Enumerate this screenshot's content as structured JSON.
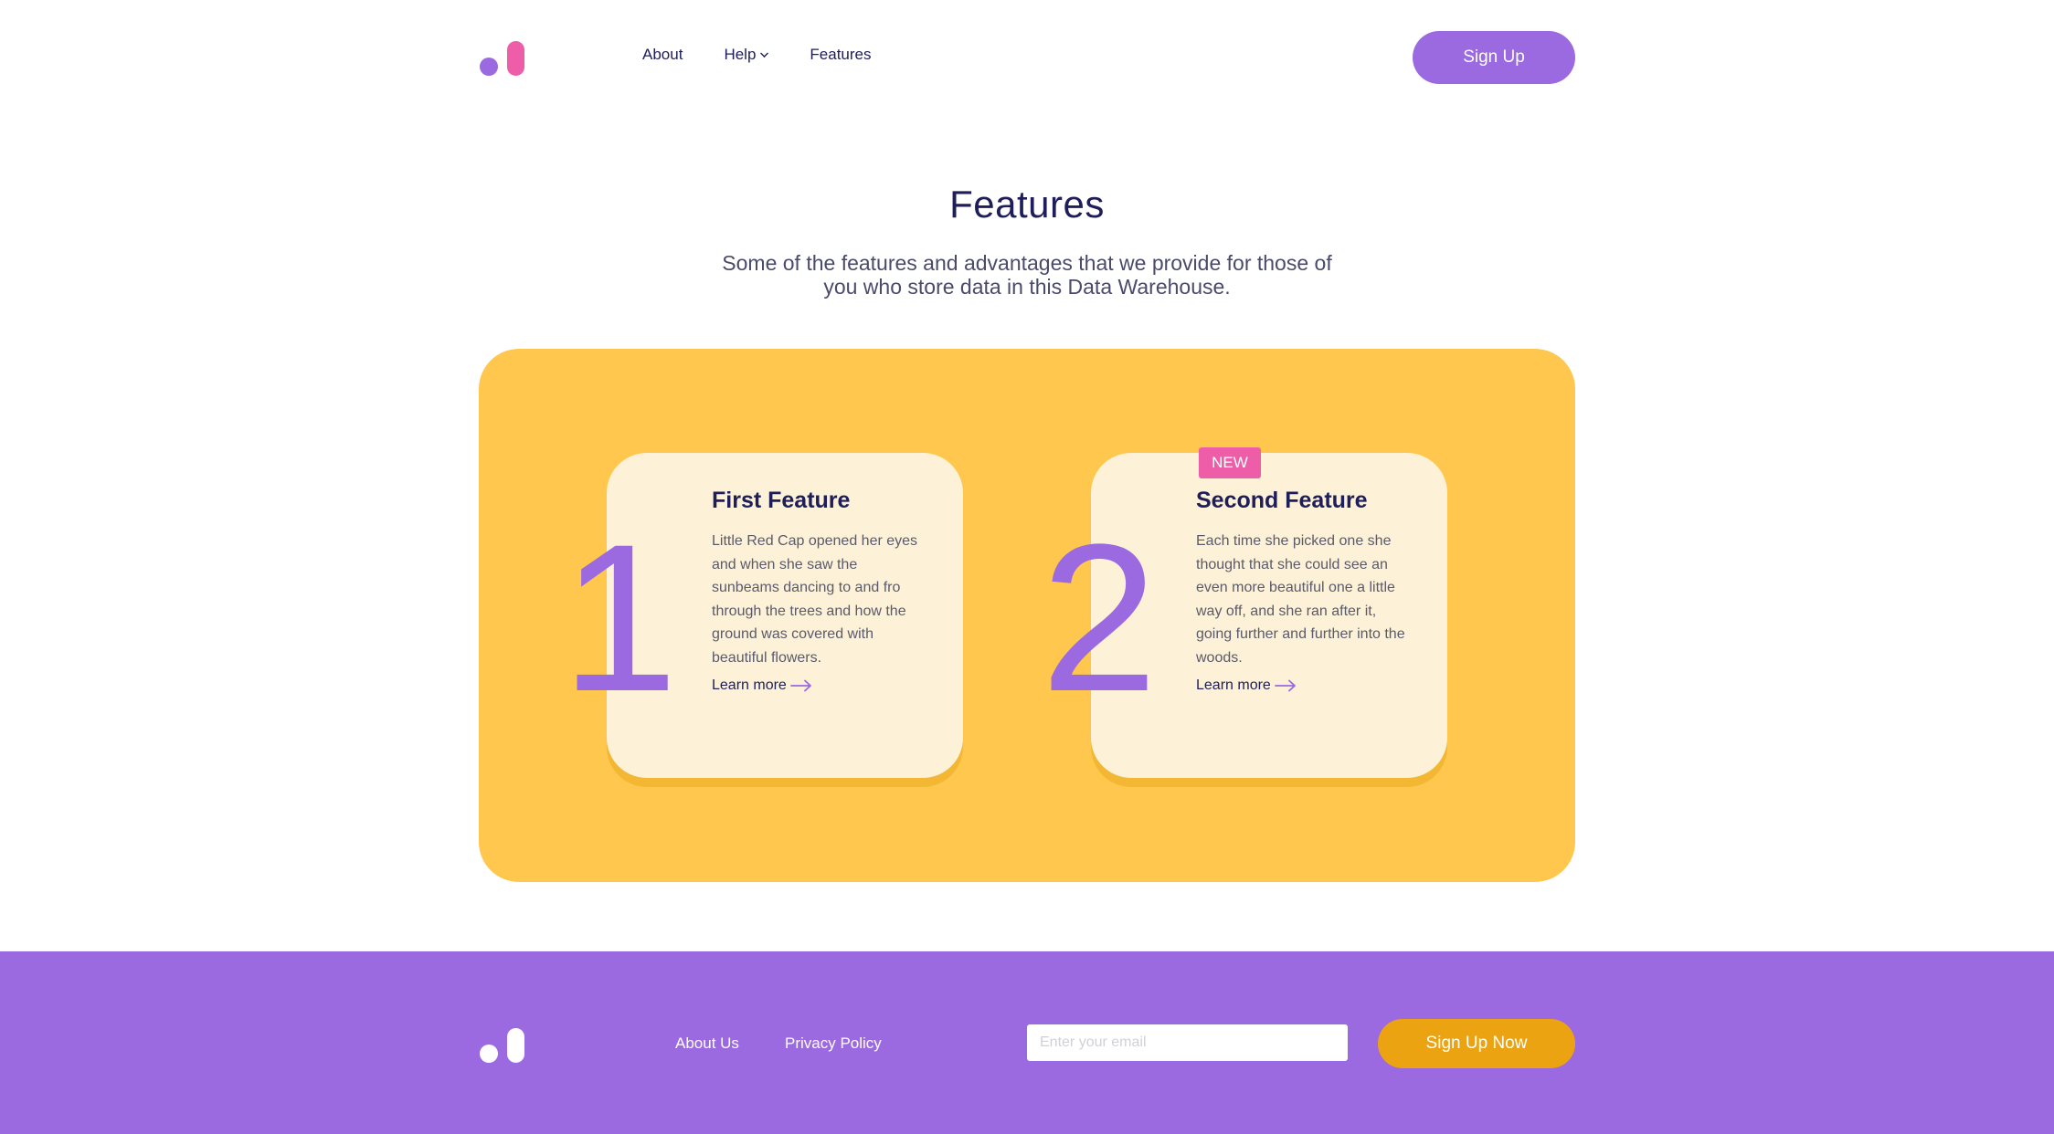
{
  "colors": {
    "accent_purple": "#9b69e0",
    "accent_pink": "#ee5da8",
    "panel_yellow": "#ffc74d",
    "card_cream": "#fdf2d8",
    "footer_button_orange": "#eba312",
    "text_navy": "#1e1e5a"
  },
  "header": {
    "logo_icon": "logo-mark",
    "nav": [
      {
        "label": "About"
      },
      {
        "label": "Help",
        "icon": "chevron-down-icon"
      },
      {
        "label": "Features"
      }
    ],
    "signup_label": "Sign Up"
  },
  "hero": {
    "title": "Features",
    "subtitle": "Some of the features and advantages that we provide for those of you who store data in this Data Warehouse."
  },
  "features": [
    {
      "number": "1",
      "title": "First Feature",
      "text": "Little Red Cap opened her eyes and when she saw the sunbeams dancing to and fro through the trees and how the ground was covered with beautiful flowers.",
      "link": "Learn more",
      "link_icon": "arrow-right-icon"
    },
    {
      "number": "2",
      "badge": "NEW",
      "title": "Second Feature",
      "text": "Each time she picked one she thought that she could see an even more beautiful one a little way off, and she ran after it, going further and further into the woods.",
      "link": "Learn more",
      "link_icon": "arrow-right-icon"
    }
  ],
  "footer": {
    "links": [
      "About Us",
      "Privacy Policy"
    ],
    "email_placeholder": "Enter your email",
    "email_value": "",
    "signup_label": "Sign Up Now"
  }
}
